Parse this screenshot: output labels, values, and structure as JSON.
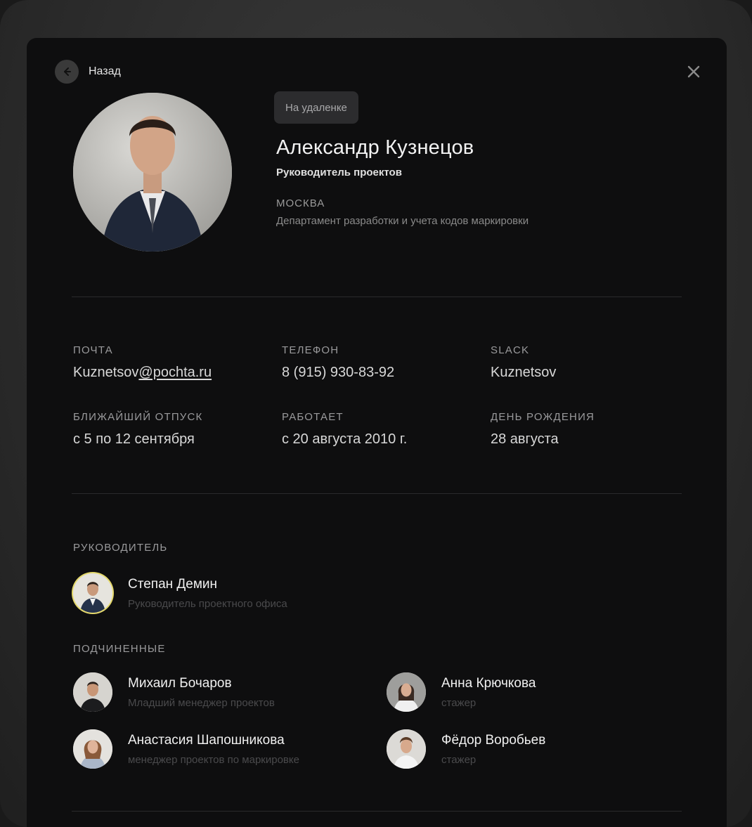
{
  "header": {
    "back_label": "Назад"
  },
  "profile": {
    "status": "На удаленке",
    "name": "Александр Кузнецов",
    "position": "Руководитель проектов",
    "city": "МОСКВА",
    "department": "Департамент разработки  и учета кодов маркировки"
  },
  "info": {
    "email_label": "ПОЧТА",
    "email_user": "Kuznetsov",
    "email_domain": "@pochta.ru",
    "phone_label": "ТЕЛЕФОН",
    "phone": "8 (915) 930-83-92",
    "slack_label": "SLACK",
    "slack": "Kuznetsov",
    "vacation_label": "БЛИЖАЙШИЙ ОТПУСК",
    "vacation": "с 5 по 12 сентября",
    "works_label": "РАБОТАЕТ",
    "works": "с 20 августа 2010 г.",
    "birthday_label": "ДЕНЬ РОЖДЕНИЯ",
    "birthday": "28 августа"
  },
  "manager": {
    "label": "РУКОВОДИТЕЛЬ",
    "name": "Степан Демин",
    "role": "Руководитель проектного офиса"
  },
  "subordinates": {
    "label": "ПОДЧИНЕННЫЕ",
    "items": [
      {
        "name": "Михаил Бочаров",
        "role": "Младший менеджер проектов"
      },
      {
        "name": "Анна Крючкова",
        "role": "стажер"
      },
      {
        "name": "Анастасия Шапошникова",
        "role": "менеджер проектов по маркировке"
      },
      {
        "name": "Фёдор Воробьев",
        "role": "стажер"
      }
    ]
  },
  "icons": {
    "back": "arrow-left-icon",
    "close": "close-icon"
  },
  "colors": {
    "card_bg": "#0e0e0f",
    "badge_bg": "#2c2c2e",
    "manager_ring": "#e5d96b"
  }
}
